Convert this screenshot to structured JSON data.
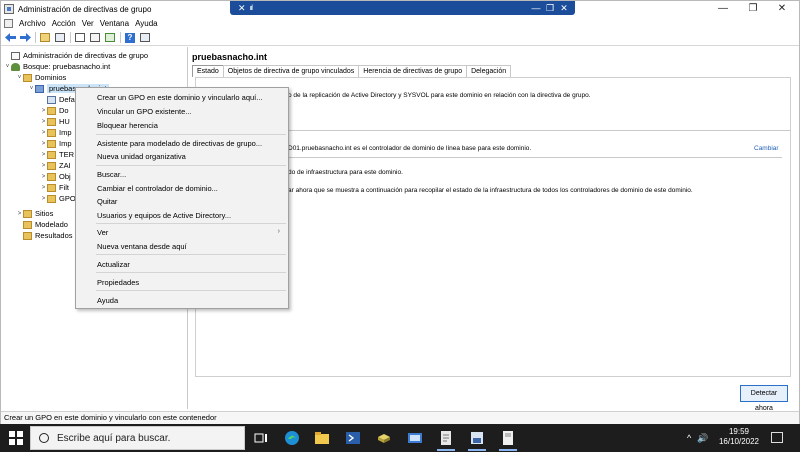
{
  "window": {
    "title": "Administración de directivas de grupo",
    "controls": {
      "minimize": "—",
      "restore": "❐",
      "close": "✕"
    }
  },
  "rdp": {
    "signal": "ııl",
    "minimize": "—",
    "restore": "❐",
    "close": "✕"
  },
  "menubar": [
    "Archivo",
    "Acción",
    "Ver",
    "Ventana",
    "Ayuda"
  ],
  "toolbar": {
    "icons": [
      "back-arrow-icon",
      "forward-arrow-icon",
      "folder-up-icon",
      "console-tree-icon",
      "properties-icon",
      "export-icon",
      "refresh-icon",
      "help-icon",
      "view-icon"
    ]
  },
  "tree": {
    "items": [
      {
        "label": "Administración de directivas de grupo",
        "icon": "gpmc-icon",
        "expander": ""
      },
      {
        "label": "Bosque: pruebasnacho.int",
        "icon": "forest-icon",
        "expander": "˅"
      },
      {
        "label": "Dominios",
        "icon": "folder-icon",
        "expander": "˅"
      },
      {
        "label": "pruebasnacho.int",
        "icon": "domain-icon",
        "expander": "˅"
      },
      {
        "label": "Defa",
        "icon": "gpo-icon",
        "expander": ""
      },
      {
        "label": "Do",
        "icon": "folder-icon",
        "expander": ">"
      },
      {
        "label": "HU",
        "icon": "folder-icon",
        "expander": ">"
      },
      {
        "label": "Imp",
        "icon": "folder-icon",
        "expander": ">"
      },
      {
        "label": "Imp",
        "icon": "folder-icon",
        "expander": ">"
      },
      {
        "label": "TER",
        "icon": "folder-icon",
        "expander": ">"
      },
      {
        "label": "ZAI",
        "icon": "folder-icon",
        "expander": ">"
      },
      {
        "label": "Obj",
        "icon": "folder-icon",
        "expander": ">"
      },
      {
        "label": "Filt",
        "icon": "folder-icon",
        "expander": ">"
      },
      {
        "label": "GPO",
        "icon": "folder-icon",
        "expander": ">"
      },
      {
        "label": "Sitios",
        "icon": "folder-icon",
        "expander": ">"
      },
      {
        "label": "Modelado",
        "icon": "folder-icon",
        "expander": ""
      },
      {
        "label": "Resultados",
        "icon": "folder-icon",
        "expander": ""
      }
    ]
  },
  "main": {
    "title": "pruebasnacho.int",
    "tabs": [
      "Estado",
      "Objetos de directiva de grupo vinculados",
      "Herencia de directivas de grupo",
      "Delegación"
    ],
    "text_line1": "o de la replicación de Active Directory y SYSVOL para este dominio en relación con la directiva de grupo.",
    "text_line2": "D01.pruebasnacho.int es el controlador de dominio de línea base para este dominio.",
    "change_link": "Cambiar",
    "text_line3": "do de infraestructura para este dominio.",
    "text_line4": "ar ahora que se muestra a continuación para recopilar el estado de la infraestructura de todos los controladores de dominio de este dominio.",
    "detect_button": "Detectar ahora"
  },
  "context_menu": {
    "items": [
      "Crear un GPO en este dominio y vincularlo aquí...",
      "Vincular un GPO existente...",
      "Bloquear herencia",
      "Asistente para modelado de directivas de grupo...",
      "Nueva unidad organizativa",
      "Buscar...",
      "Cambiar el controlador de dominio...",
      "Quitar",
      "Usuarios y equipos de Active Directory...",
      "Ver",
      "Nueva ventana desde aquí",
      "Actualizar",
      "Propiedades",
      "Ayuda"
    ],
    "submenu_arrow": "›"
  },
  "statusbar": {
    "text": "Crear un GPO en este dominio y vincularlo con este contenedor"
  },
  "taskbar": {
    "search_placeholder": "Escribe aquí para buscar.",
    "apps": [
      "task-view-icon",
      "edge-icon",
      "file-explorer-icon",
      "powershell-icon",
      "server-manager-icon",
      "control-panel-icon",
      "notepad-icon",
      "gpmc-taskbar-icon",
      "window-taskbar-icon"
    ],
    "time": "19:59",
    "date": "16/10/2022",
    "tray_arrow": "^",
    "volume_icon": "🔊"
  }
}
